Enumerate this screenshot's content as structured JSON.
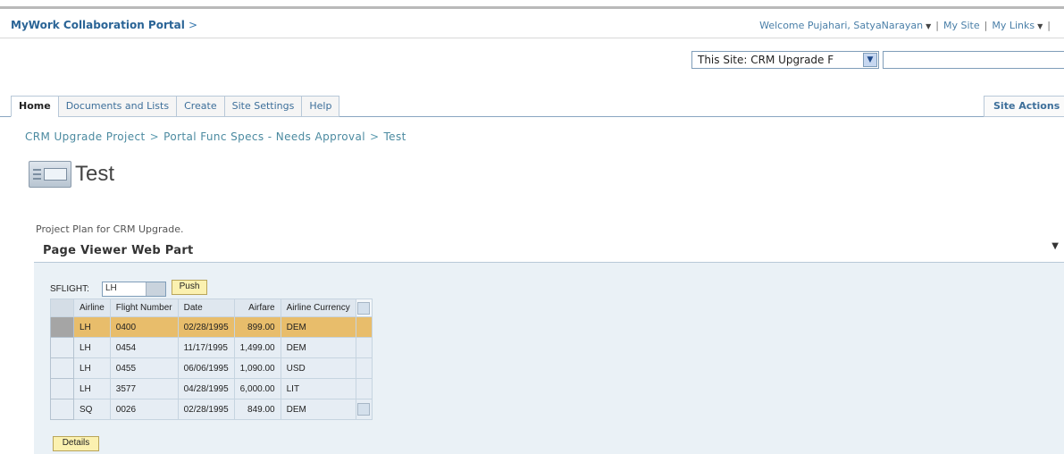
{
  "header": {
    "brand": "MyWork Collaboration Portal",
    "brand_arrow": ">",
    "welcome": "Welcome Pujahari, SatyaNarayan",
    "my_site": "My Site",
    "my_links": "My Links",
    "separator": "|"
  },
  "search": {
    "scope_label": "This Site: CRM Upgrade F",
    "search_value": ""
  },
  "tabs": [
    {
      "label": "Home"
    },
    {
      "label": "Documents and Lists"
    },
    {
      "label": "Create"
    },
    {
      "label": "Site Settings"
    },
    {
      "label": "Help"
    }
  ],
  "site_actions": "Site Actions",
  "breadcrumb": {
    "items": [
      "CRM Upgrade Project",
      "Portal Func Specs - Needs Approval",
      "Test"
    ],
    "separator": ">"
  },
  "page": {
    "title": "Test",
    "description": "Project Plan for CRM Upgrade."
  },
  "webpart": {
    "title": "Page Viewer Web Part",
    "menu_glyph": "▼",
    "sflight_label": "SFLIGHT:",
    "sflight_value": "LH",
    "push_label": "Push",
    "details_label": "Details",
    "columns": [
      "Airline",
      "Flight Number",
      "Date",
      "Airfare",
      "Airline Currency"
    ],
    "rows": [
      {
        "airline": "LH",
        "flight": "0400",
        "date": "02/28/1995",
        "fare": "899.00",
        "currency": "DEM"
      },
      {
        "airline": "LH",
        "flight": "0454",
        "date": "11/17/1995",
        "fare": "1,499.00",
        "currency": "DEM"
      },
      {
        "airline": "LH",
        "flight": "0455",
        "date": "06/06/1995",
        "fare": "1,090.00",
        "currency": "USD"
      },
      {
        "airline": "LH",
        "flight": "3577",
        "date": "04/28/1995",
        "fare": "6,000.00",
        "currency": "LIT"
      },
      {
        "airline": "SQ",
        "flight": "0026",
        "date": "02/28/1995",
        "fare": "849.00",
        "currency": "DEM"
      }
    ],
    "selected_row": 0
  },
  "colors": {
    "brand": "#2a6496",
    "link": "#4b8aa0",
    "highlight_row": "#e8bd6b",
    "button": "#fbf1b0",
    "webpart_bg": "#eaf1f6"
  }
}
